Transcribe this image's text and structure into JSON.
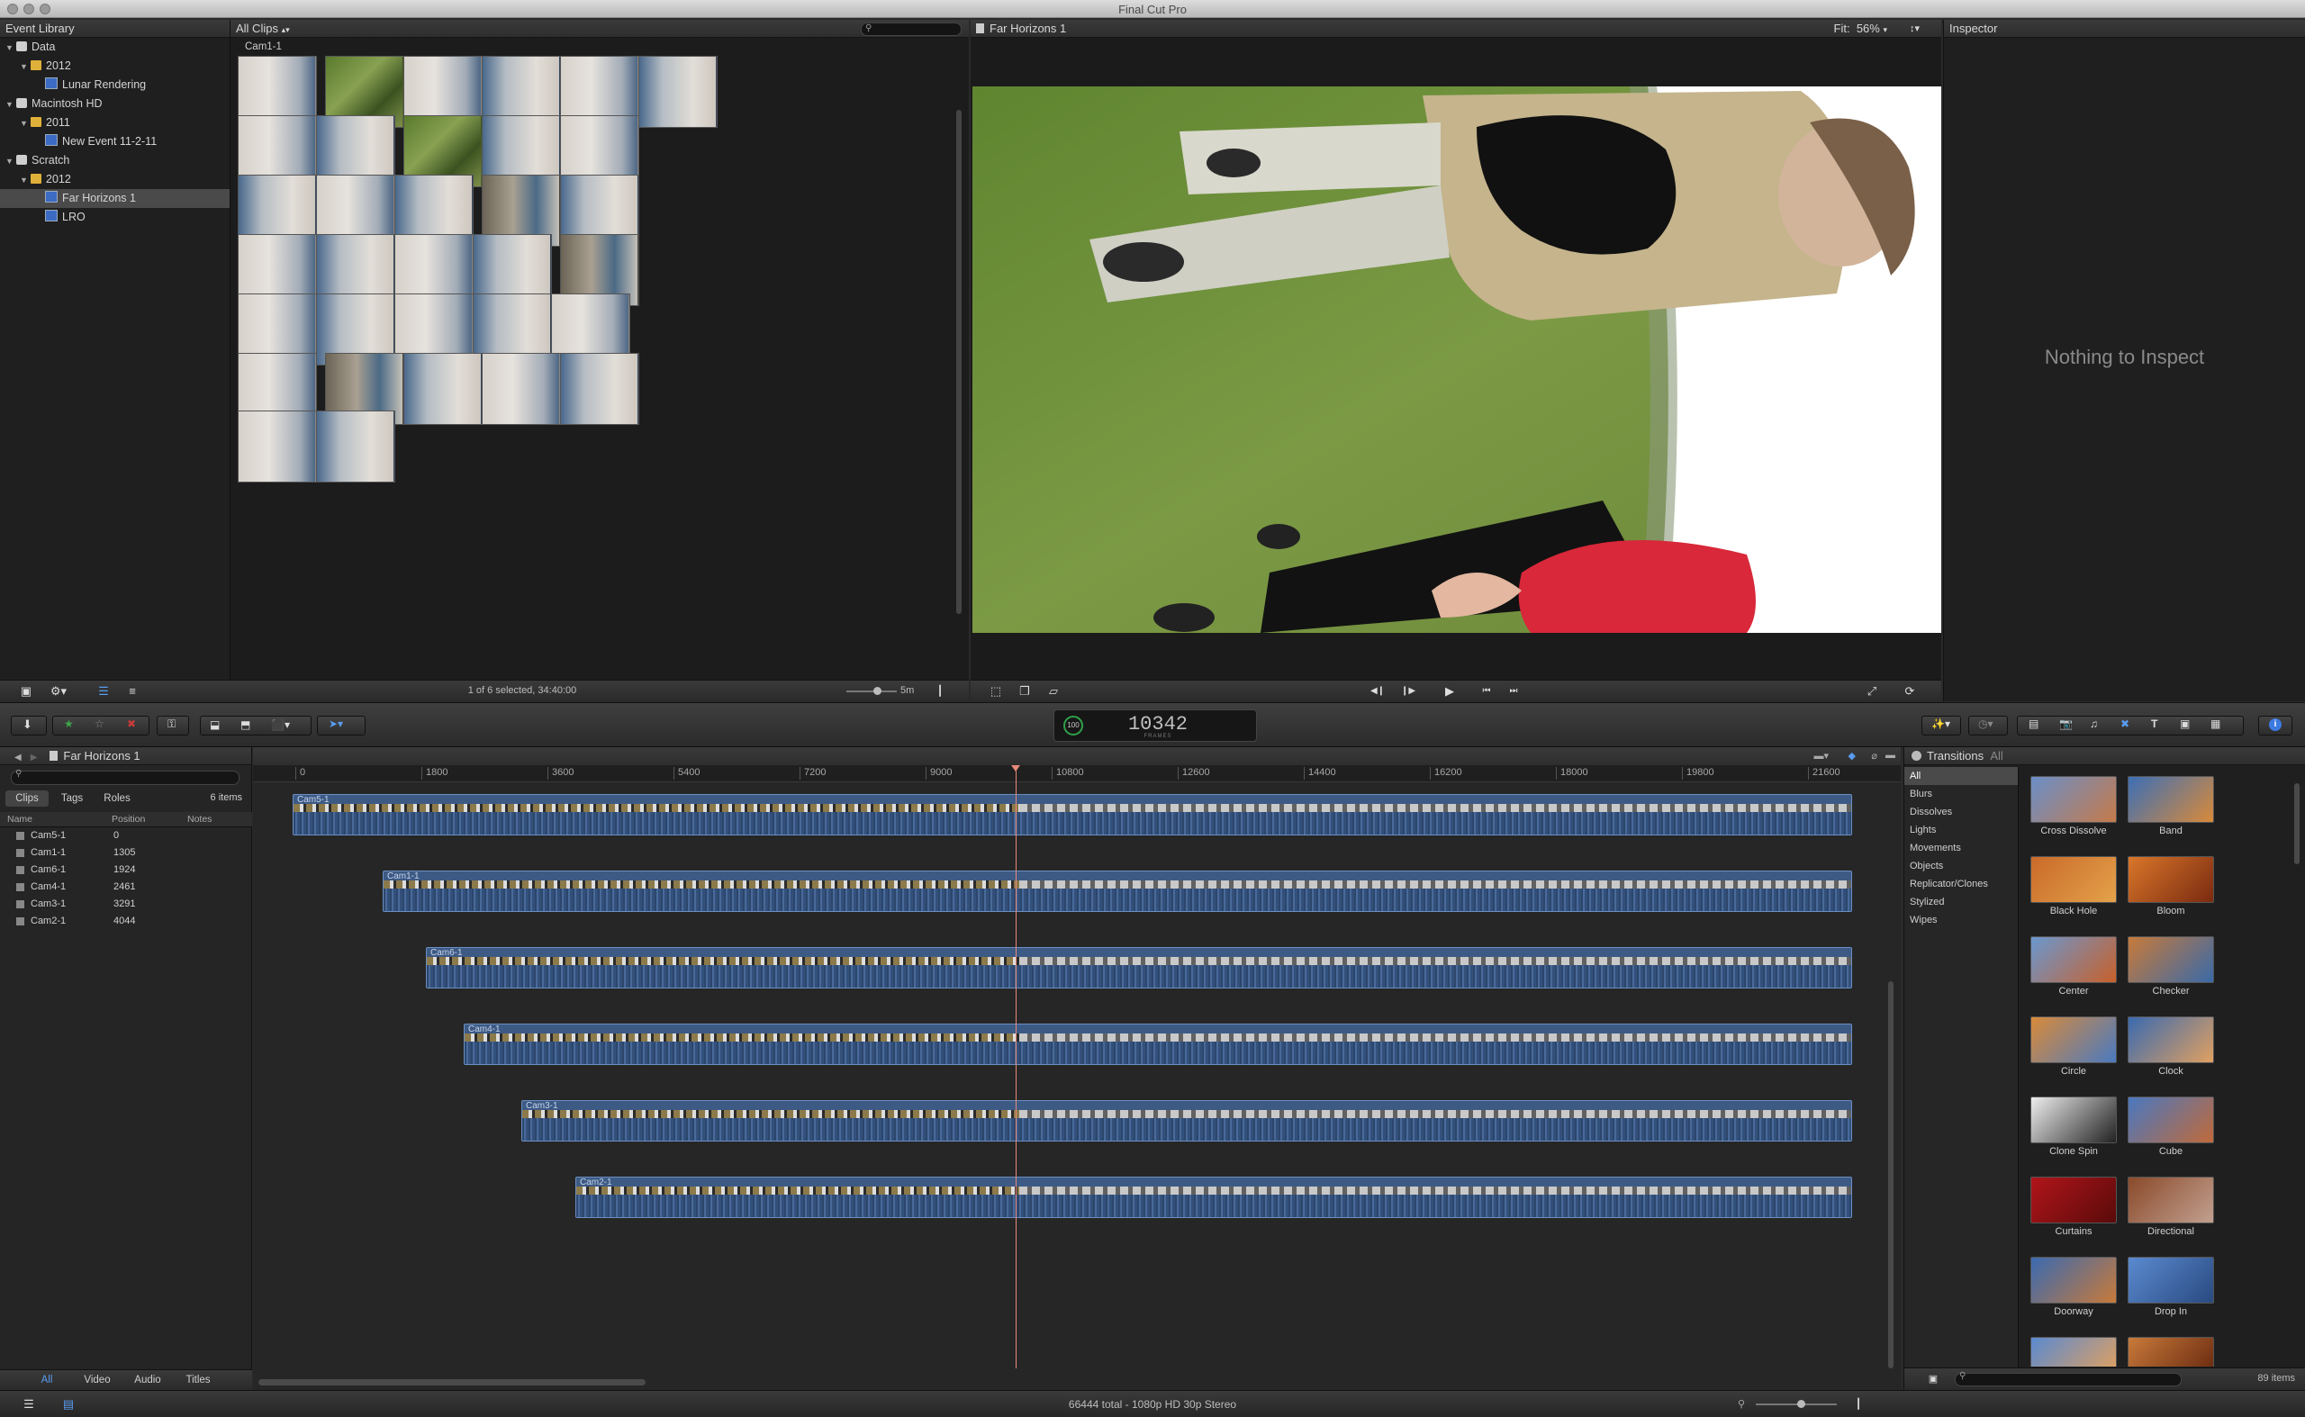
{
  "window": {
    "title": "Final Cut Pro"
  },
  "library": {
    "header": "Event Library",
    "items": [
      {
        "label": "Data",
        "level": 0,
        "kind": "drive",
        "open": true
      },
      {
        "label": "2012",
        "level": 1,
        "kind": "folder",
        "open": true
      },
      {
        "label": "Lunar Rendering",
        "level": 2,
        "kind": "event"
      },
      {
        "label": "Macintosh HD",
        "level": 0,
        "kind": "drive",
        "open": true
      },
      {
        "label": "2011",
        "level": 1,
        "kind": "folder",
        "open": true
      },
      {
        "label": "New Event 11-2-11",
        "level": 2,
        "kind": "event"
      },
      {
        "label": "Scratch",
        "level": 0,
        "kind": "drive",
        "open": true
      },
      {
        "label": "2012",
        "level": 1,
        "kind": "folder",
        "open": true
      },
      {
        "label": "Far Horizons 1",
        "level": 2,
        "kind": "event",
        "selected": true
      },
      {
        "label": "LRO",
        "level": 2,
        "kind": "event"
      }
    ]
  },
  "browser": {
    "filter": "All Clips",
    "clip_labels": [
      "Cam1-1",
      "Cam2-1",
      "Cam3-1",
      "Cam4-1",
      "Cam5-1",
      "Cam6-1"
    ],
    "status": "1 of 6 selected, 34:40:00",
    "zoom": "5m"
  },
  "viewer": {
    "title": "Far Horizons 1",
    "fit_label": "Fit:",
    "fit_value": "56%"
  },
  "inspector": {
    "header": "Inspector",
    "empty_text": "Nothing to Inspect"
  },
  "toolbar": {
    "timecode": "10342",
    "timecode_unit": "FRAMES",
    "speed_badge": "100"
  },
  "timeline": {
    "title": "Far Horizons 1",
    "ruler": [
      "0",
      "1800",
      "3600",
      "5400",
      "7200",
      "9000",
      "10800",
      "12600",
      "14400",
      "16200",
      "18000",
      "19800",
      "21600"
    ],
    "tracks": [
      {
        "label": "Cam5-1"
      },
      {
        "label": "Cam1-1"
      },
      {
        "label": "Cam6-1"
      },
      {
        "label": "Cam4-1"
      },
      {
        "label": "Cam3-1"
      },
      {
        "label": "Cam2-1"
      }
    ],
    "status": "66444 total - 1080p HD 30p Stereo"
  },
  "index": {
    "tabs": [
      "Clips",
      "Tags",
      "Roles"
    ],
    "count": "6 items",
    "columns": [
      "Name",
      "Position",
      "Notes"
    ],
    "rows": [
      {
        "name": "Cam5-1",
        "position": "0"
      },
      {
        "name": "Cam1-1",
        "position": "1305"
      },
      {
        "name": "Cam6-1",
        "position": "1924"
      },
      {
        "name": "Cam4-1",
        "position": "2461"
      },
      {
        "name": "Cam3-1",
        "position": "3291"
      },
      {
        "name": "Cam2-1",
        "position": "4044"
      }
    ],
    "bottom_tabs": [
      "All",
      "Video",
      "Audio",
      "Titles"
    ]
  },
  "transitions": {
    "header": "Transitions",
    "header_filter": "All",
    "categories": [
      "All",
      "Blurs",
      "Dissolves",
      "Lights",
      "Movements",
      "Objects",
      "Replicator/Clones",
      "Stylized",
      "Wipes"
    ],
    "items": [
      "Cross Dissolve",
      "Band",
      "Black Hole",
      "Bloom",
      "Center",
      "Checker",
      "Circle",
      "Clock",
      "Clone Spin",
      "Cube",
      "Curtains",
      "Directional",
      "Doorway",
      "Drop In"
    ],
    "count": "89 items"
  },
  "colors": {
    "accent": "#3b7ae0",
    "track": "#3d5a85",
    "playhead": "#e88a7a"
  }
}
